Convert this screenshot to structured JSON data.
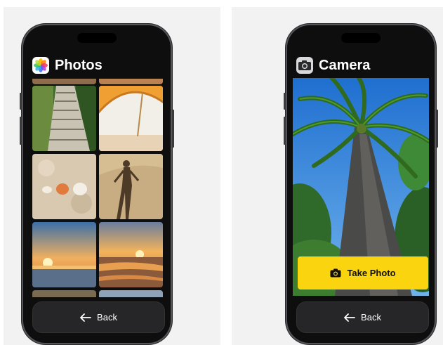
{
  "photos_screen": {
    "app_title": "Photos",
    "app_icon": "photos-app-icon",
    "back_label": "Back",
    "back_icon": "arrow-left-icon",
    "thumbnails": [
      "stone-stairs-photo",
      "beach-umbrella-photo",
      "seashells-photo",
      "shadow-on-sand-photo",
      "sunset-photo",
      "ocean-sunset-photo"
    ]
  },
  "camera_screen": {
    "app_title": "Camera",
    "app_icon": "camera-app-icon",
    "take_photo_label": "Take Photo",
    "take_photo_icon": "camera-icon",
    "back_label": "Back",
    "back_icon": "arrow-left-icon"
  },
  "colors": {
    "accent_yellow": "#f9d40f",
    "button_dark": "#262628",
    "phone_body": "#0e0e0e"
  }
}
